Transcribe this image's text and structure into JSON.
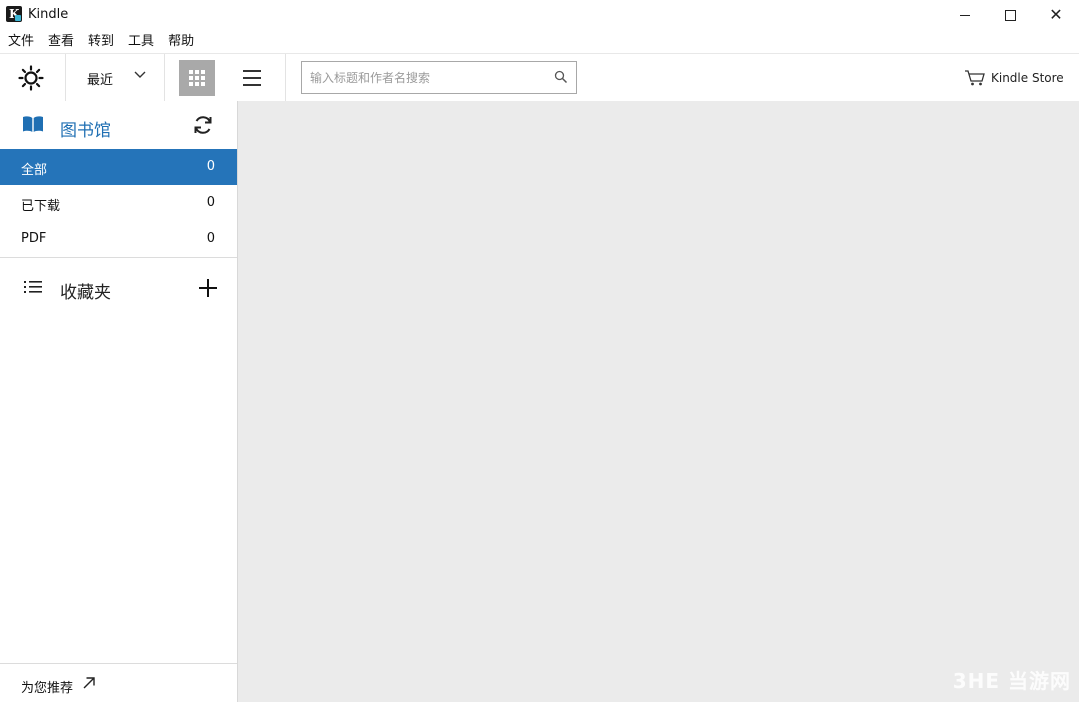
{
  "window": {
    "title": "Kindle",
    "close_glyph": "✕"
  },
  "menu": [
    "文件",
    "查看",
    "转到",
    "工具",
    "帮助"
  ],
  "toolbar": {
    "sort_label": "最近",
    "view_mode": "grid",
    "search_placeholder": "输入标题和作者名搜索",
    "store_label": "Kindle Store"
  },
  "sidebar": {
    "library_title": "图书馆",
    "filters": [
      {
        "label": "全部",
        "count": "0",
        "selected": true
      },
      {
        "label": "已下载",
        "count": "0",
        "selected": false
      },
      {
        "label": "PDF",
        "count": "0",
        "selected": false
      }
    ],
    "collections_title": "收藏夹",
    "recommend_label": "为您推荐"
  },
  "watermark": "3HE 当游网",
  "colors": {
    "accent": "#2574b9",
    "library_title": "#1f6fb3",
    "content_bg": "#ebebeb",
    "grid_button_bg": "#a9a9a9"
  },
  "icons": [
    "kindle-app-icon",
    "brightness-icon",
    "chevron-down-icon",
    "grid-view-icon",
    "list-view-icon",
    "search-icon",
    "cart-icon",
    "book-icon",
    "sync-icon",
    "list-icon",
    "plus-icon",
    "external-link-icon"
  ]
}
